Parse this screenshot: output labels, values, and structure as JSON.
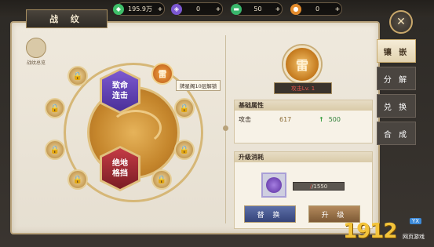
{
  "topbar": {
    "resources": [
      {
        "icon": "jade-icon",
        "value": "195.9万",
        "color": "#3fbf6a"
      },
      {
        "icon": "purple-crystal-icon",
        "value": "0",
        "color": "#7b57d1"
      },
      {
        "icon": "green-gem-icon",
        "value": "50",
        "color": "#39b66b"
      },
      {
        "icon": "orange-gem-icon",
        "value": "0",
        "color": "#e38b2c"
      }
    ],
    "plus": "+"
  },
  "panel": {
    "title": "战 纹",
    "close": "✕"
  },
  "overview": {
    "label": "战纹总览"
  },
  "side_tabs": [
    "镶 嵌",
    "分 解",
    "兑 换",
    "合 成"
  ],
  "wheel": {
    "slot_top": "致命\n连击",
    "slot_bottom": "绝地\n格挡",
    "small_gem_glyph": "雷",
    "tooltip": "牌星阁10层解锁"
  },
  "detail": {
    "rune_glyph": "雷",
    "level_label": "攻击Lv. 1",
    "base_title": "基础属性",
    "stat_name": "攻击",
    "stat_value": "617",
    "stat_bonus": "500",
    "cost_title": "升级消耗",
    "cost_have": "/1550",
    "swap_btn": "替 换",
    "upgrade_btn": "升 级"
  },
  "brand": {
    "num": "1912",
    "yx": "YX",
    "sub": "网页游戏"
  }
}
